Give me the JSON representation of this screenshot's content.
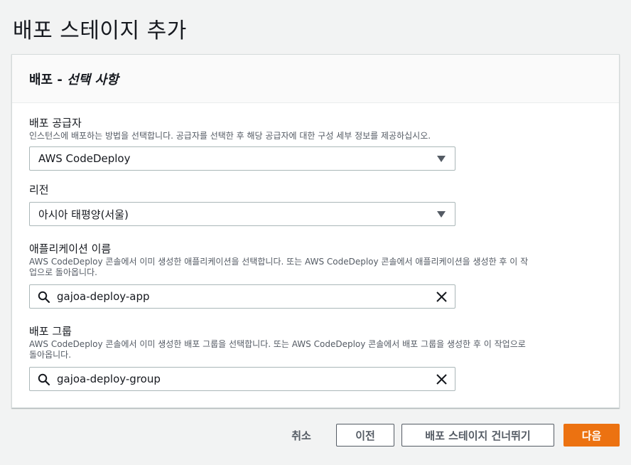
{
  "page": {
    "title": "배포 스테이지 추가"
  },
  "panel": {
    "title_main": "배포 - ",
    "title_optional": "선택 사항"
  },
  "fields": {
    "provider": {
      "label": "배포 공급자",
      "description": "인스턴스에 배포하는 방법을 선택합니다. 공급자를 선택한 후 해당 공급자에 대한 구성 세부 정보를 제공하십시오.",
      "value": "AWS CodeDeploy"
    },
    "region": {
      "label": "리전",
      "value": "아시아 태평양(서울)"
    },
    "application": {
      "label": "애플리케이션 이름",
      "description_line1": "AWS CodeDeploy 콘솔에서 이미 생성한 애플리케이션을 선택합니다. 또는 AWS CodeDeploy 콘솔에서 애플리케이션을 생성한 후 이 작",
      "description_line2": "업으로 돌아옵니다.",
      "value": "gajoa-deploy-app"
    },
    "deploy_group": {
      "label": "배포 그룹",
      "description_line1": "AWS CodeDeploy 콘솔에서 이미 생성한 배포 그룹을 선택합니다. 또는 AWS CodeDeploy 콘솔에서 배포 그룹을 생성한 후 이 작업으로",
      "description_line2": "돌아옵니다.",
      "value": "gajoa-deploy-group"
    }
  },
  "footer": {
    "cancel": "취소",
    "previous": "이전",
    "skip": "배포 스테이지 건너뛰기",
    "next": "다음"
  },
  "colors": {
    "primary": "#ec7211",
    "border": "#aab7b8",
    "text": "#16191f",
    "muted": "#545b64"
  },
  "icons": {
    "dropdown": "caret-down-icon",
    "search": "search-icon",
    "clear": "close-icon"
  }
}
